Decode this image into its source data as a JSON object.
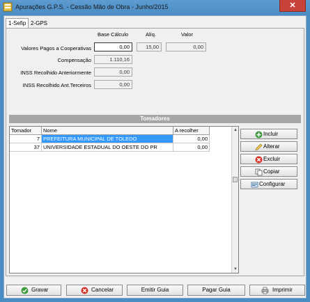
{
  "window": {
    "title": "Apurações G.P.S. - Cessão Mão de Obra - Junho/2015",
    "close_glyph": "✕"
  },
  "tabs": [
    {
      "label": "1-Sefip",
      "active": true
    },
    {
      "label": "2-GPS",
      "active": false
    }
  ],
  "form": {
    "col_base": "Base Cálculo",
    "col_aliq": "Alíq.",
    "col_valor": "Valor",
    "rows": [
      {
        "label": "Valores Pagos a Cooperativas",
        "base": "0,00",
        "aliq": "15,00",
        "valor": "0,00"
      },
      {
        "label": "Compensação",
        "base": "1.110,16"
      },
      {
        "label": "INSS Recolhido Anteriormente",
        "base": "0,00"
      },
      {
        "label": "INSS Recolhido Ant.Terceiros",
        "base": "0,00"
      }
    ]
  },
  "tomadores": {
    "header": "Tomadores",
    "columns": [
      "Tomador",
      "Nome",
      "A recolher"
    ],
    "rows": [
      {
        "tomador": "7",
        "nome": "PREFEITURA MUNICIPAL DE TOLEDO",
        "recolher": "0,00",
        "selected": true
      },
      {
        "tomador": "37",
        "nome": "UNIVERSIDADE ESTADUAL DO OESTE DO PR",
        "recolher": "0,00",
        "selected": false
      }
    ],
    "actions": [
      {
        "label": "Incluir",
        "icon": "plus-icon"
      },
      {
        "label": "Alterar",
        "icon": "pencil-icon"
      },
      {
        "label": "Excluir",
        "icon": "delete-icon"
      },
      {
        "label": "Copiar",
        "icon": "copy-icon"
      },
      {
        "label": "Configurar",
        "icon": "config-icon"
      }
    ]
  },
  "footer": {
    "gravar": "Gravar",
    "cancelar": "Cancelar",
    "emitir": "Emitir Guia",
    "pagar": "Pagar Guia",
    "imprimir": "Imprimir"
  },
  "colors": {
    "title_bar": "#4a8cc4",
    "close": "#c7423b",
    "selection": "#3399ff",
    "section_header": "#a6a6a6"
  }
}
